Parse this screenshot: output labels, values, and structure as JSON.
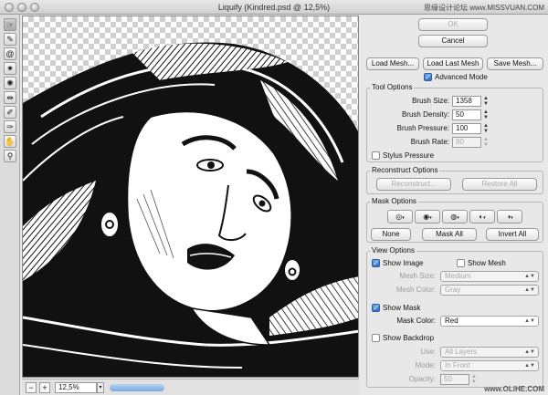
{
  "window": {
    "title": "Liquify (Kindred.psd @ 12,5%)",
    "watermark_top": "思缘设计论坛 www.MISSVUAN.COM",
    "watermark_bottom": "www.OLiHE.COM"
  },
  "tools": [
    {
      "icon": "forward-warp-icon",
      "glyph": "☞",
      "active": true
    },
    {
      "icon": "reconstruct-icon",
      "glyph": "✎"
    },
    {
      "icon": "twirl-clockwise-icon",
      "glyph": "@"
    },
    {
      "icon": "pucker-icon",
      "glyph": "✷"
    },
    {
      "icon": "bloat-icon",
      "glyph": "✺"
    },
    {
      "icon": "push-left-icon",
      "glyph": "⇹"
    },
    {
      "icon": "freeze-mask-icon",
      "glyph": "✐"
    },
    {
      "icon": "thaw-mask-icon",
      "glyph": "✑"
    },
    {
      "icon": "hand-icon",
      "glyph": "✋"
    },
    {
      "icon": "zoom-icon",
      "glyph": "⚲"
    }
  ],
  "status": {
    "zoom_minus": "−",
    "zoom_plus": "+",
    "zoom_value": "12,5%"
  },
  "buttons": {
    "ok": "OK",
    "cancel": "Cancel",
    "load_mesh": "Load Mesh...",
    "load_last_mesh": "Load Last Mesh",
    "save_mesh": "Save Mesh..."
  },
  "advanced_mode": {
    "label": "Advanced Mode",
    "checked": true
  },
  "tool_options": {
    "title": "Tool Options",
    "brush_size": {
      "label": "Brush Size:",
      "value": "1358"
    },
    "brush_density": {
      "label": "Brush Density:",
      "value": "50"
    },
    "brush_pressure": {
      "label": "Brush Pressure:",
      "value": "100"
    },
    "brush_rate": {
      "label": "Brush Rate:",
      "value": "80"
    },
    "stylus_pressure": {
      "label": "Stylus Pressure",
      "checked": false
    }
  },
  "reconstruct_options": {
    "title": "Reconstruct Options",
    "reconstruct": "Reconstruct...",
    "restore_all": "Restore All"
  },
  "mask_options": {
    "title": "Mask Options",
    "none": "None",
    "mask_all": "Mask All",
    "invert_all": "Invert All"
  },
  "view_options": {
    "title": "View Options",
    "show_image": {
      "label": "Show Image",
      "checked": true
    },
    "show_mesh": {
      "label": "Show Mesh",
      "checked": false
    },
    "mesh_size": {
      "label": "Mesh Size:",
      "value": "Medium"
    },
    "mesh_color": {
      "label": "Mesh Color:",
      "value": "Gray"
    },
    "show_mask": {
      "label": "Show Mask",
      "checked": true
    },
    "mask_color": {
      "label": "Mask Color:",
      "value": "Red"
    },
    "show_backdrop": {
      "label": "Show Backdrop",
      "checked": false
    },
    "use": {
      "label": "Use:",
      "value": "All Layers"
    },
    "mode": {
      "label": "Mode:",
      "value": "In Front"
    },
    "opacity": {
      "label": "Opacity:",
      "value": "50"
    }
  }
}
